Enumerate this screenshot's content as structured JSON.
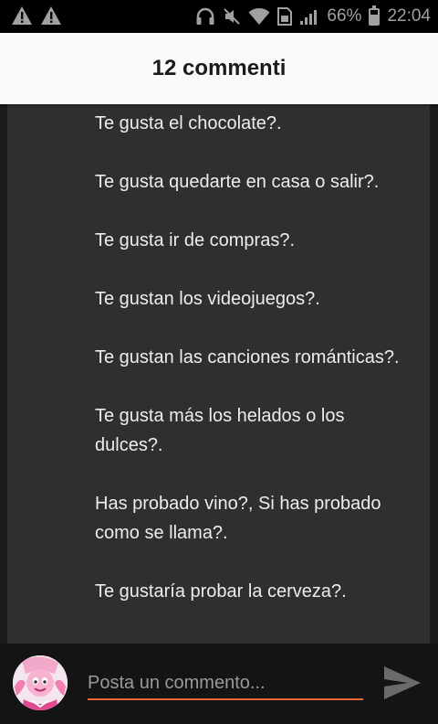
{
  "status_bar": {
    "battery_percent": "66%",
    "battery_level": 0.66,
    "time": "22:04",
    "icons": [
      "warning-icon",
      "warning-icon",
      "headphones-icon",
      "mute-icon",
      "wifi-icon",
      "sim-icon",
      "signal-icon",
      "battery-icon"
    ]
  },
  "header": {
    "title": "12 commenti"
  },
  "comment": {
    "lines": [
      "Te gusta el chocolate?.",
      "Te gusta quedarte en casa o salir?.",
      "Te gusta ir de compras?.",
      "Te gustan los videojuegos?.",
      "Te gustan las canciones románticas?.",
      "Te gusta más los helados o los dulces?.",
      "Has probado vino?, Si has probado como se llama?.",
      "Te gustaría probar la cerveza?."
    ]
  },
  "footer": {
    "placeholder": "Posta un commento...",
    "send_icon": "send-icon",
    "accent_color": "#e8663a"
  }
}
